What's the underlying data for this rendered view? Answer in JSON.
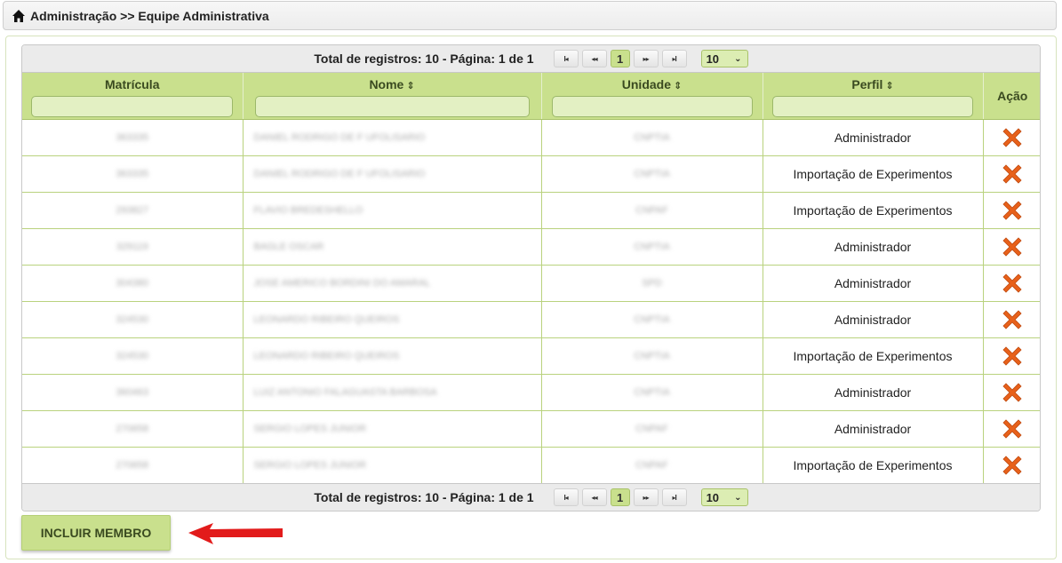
{
  "breadcrumb": {
    "text": "Administração >> Equipe Administrativa",
    "icon": "home-icon"
  },
  "pager": {
    "total_text": "Total de registros: 10 - Página: 1 de 1",
    "first": "I◂",
    "prev": "◂◂",
    "current_page": "1",
    "next": "▸▸",
    "last": "▸I",
    "rows_per_page": "10"
  },
  "columns": {
    "matricula": "Matrícula",
    "nome": "Nome",
    "unidade": "Unidade",
    "perfil": "Perfil",
    "acao": "Ação"
  },
  "rows": [
    {
      "matricula": "363335",
      "nome": "DANIEL RODRIGO DE F UFOLISARIO",
      "unidade": "CNPTIA",
      "perfil": "Administrador"
    },
    {
      "matricula": "363335",
      "nome": "DANIEL RODRIGO DE F UFOLISARIO",
      "unidade": "CNPTIA",
      "perfil": "Importação de Experimentos"
    },
    {
      "matricula": "293827",
      "nome": "FLAVIO BREDESHELLO",
      "unidade": "CNPAF",
      "perfil": "Importação de Experimentos"
    },
    {
      "matricula": "329119",
      "nome": "BAGLE OSCAR",
      "unidade": "CNPTIA",
      "perfil": "Administrador"
    },
    {
      "matricula": "304380",
      "nome": "JOSE AMERICO BORDINI DO AMARAL",
      "unidade": "SPD",
      "perfil": "Administrador"
    },
    {
      "matricula": "324530",
      "nome": "LEONARDO RIBEIRO QUEIROS",
      "unidade": "CNPTIA",
      "perfil": "Administrador"
    },
    {
      "matricula": "324530",
      "nome": "LEONARDO RIBEIRO QUEIROS",
      "unidade": "CNPTIA",
      "perfil": "Importação de Experimentos"
    },
    {
      "matricula": "360463",
      "nome": "LUIZ ANTONIO FALAGUASTA BARBOSA",
      "unidade": "CNPTIA",
      "perfil": "Administrador"
    },
    {
      "matricula": "270658",
      "nome": "SERGIO LOPES JUNIOR",
      "unidade": "CNPAF",
      "perfil": "Administrador"
    },
    {
      "matricula": "270658",
      "nome": "SERGIO LOPES JUNIOR",
      "unidade": "CNPAF",
      "perfil": "Importação de Experimentos"
    }
  ],
  "actions": {
    "add_member": "INCLUIR MEMBRO",
    "delete_icon": "delete-icon"
  },
  "colors": {
    "accent_green": "#c9e08d",
    "delete_orange": "#e8611a",
    "arrow_red": "#e21b1b"
  }
}
